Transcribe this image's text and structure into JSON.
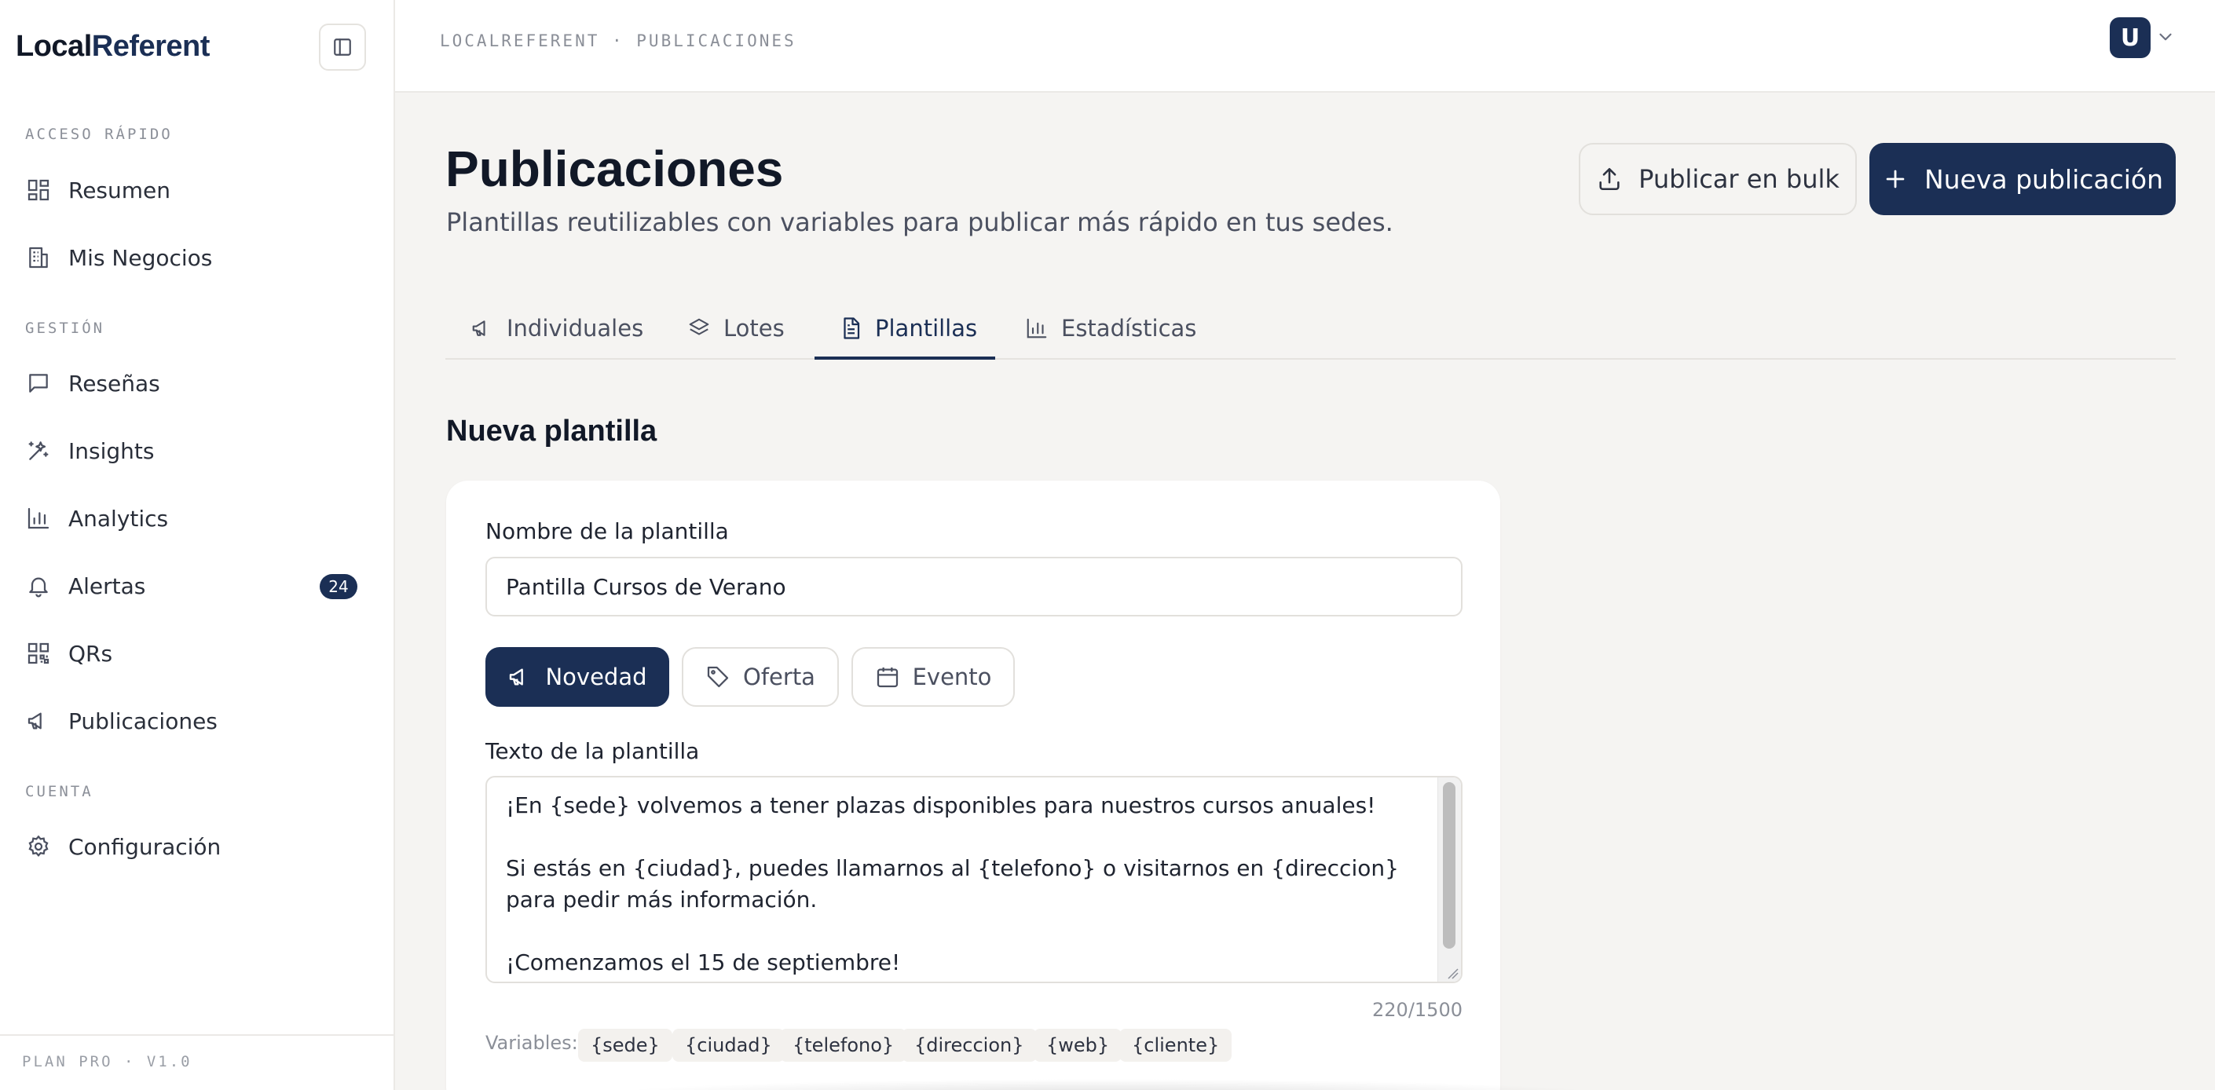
{
  "sidebar": {
    "logo_part1": "Local",
    "logo_part2": "Referent",
    "sections": {
      "quick": "ACCESO RÁPIDO",
      "manage": "GESTIÓN",
      "account": "CUENTA"
    },
    "items": [
      {
        "label": "Resumen",
        "icon": "dashboard-icon"
      },
      {
        "label": "Mis Negocios",
        "icon": "building-icon"
      },
      {
        "label": "Reseñas",
        "icon": "message-square-icon"
      },
      {
        "label": "Insights",
        "icon": "sparkles-icon"
      },
      {
        "label": "Analytics",
        "icon": "bar-chart-icon"
      },
      {
        "label": "Alertas",
        "icon": "bell-icon",
        "badge": "24"
      },
      {
        "label": "QRs",
        "icon": "qr-code-icon"
      },
      {
        "label": "Publicaciones",
        "icon": "megaphone-icon"
      },
      {
        "label": "Configuración",
        "icon": "gear-icon"
      }
    ],
    "footer": "PLAN PRO · V1.0"
  },
  "topbar": {
    "breadcrumb": "LOCALREFERENT · PUBLICACIONES",
    "avatar_initial": "U"
  },
  "header": {
    "title": "Publicaciones",
    "subtitle": "Plantillas reutilizables con variables para publicar más rápido en tus sedes.",
    "bulk_button": "Publicar en bulk",
    "new_button": "Nueva publicación"
  },
  "tabs": [
    {
      "label": "Individuales",
      "icon": "megaphone-icon"
    },
    {
      "label": "Lotes",
      "icon": "layers-icon"
    },
    {
      "label": "Plantillas",
      "icon": "file-text-icon",
      "active": true
    },
    {
      "label": "Estadísticas",
      "icon": "bar-chart-icon"
    }
  ],
  "form": {
    "section_title": "Nueva plantilla",
    "name_label": "Nombre de la plantilla",
    "name_value": "Pantilla Cursos de Verano",
    "types": [
      {
        "label": "Novedad",
        "icon": "megaphone-icon",
        "selected": true
      },
      {
        "label": "Oferta",
        "icon": "tag-icon",
        "selected": false
      },
      {
        "label": "Evento",
        "icon": "calendar-icon",
        "selected": false
      }
    ],
    "text_label": "Texto de la plantilla",
    "text_value": "¡En {sede} volvemos a tener plazas disponibles para nuestros cursos anuales!\n\nSi estás en {ciudad}, puedes llamarnos al {telefono} o visitarnos en {direccion} para pedir más información.\n\n¡Comenzamos el 15 de septiembre!",
    "char_count": "220/1500",
    "variables_label": "Variables:",
    "variables": [
      "{sede}",
      "{ciudad}",
      "{telefono}",
      "{direccion}",
      "{web}",
      "{cliente}"
    ]
  },
  "colors": {
    "primary": "#1b2f55",
    "background": "#f5f4f2",
    "surface": "#ffffff"
  }
}
